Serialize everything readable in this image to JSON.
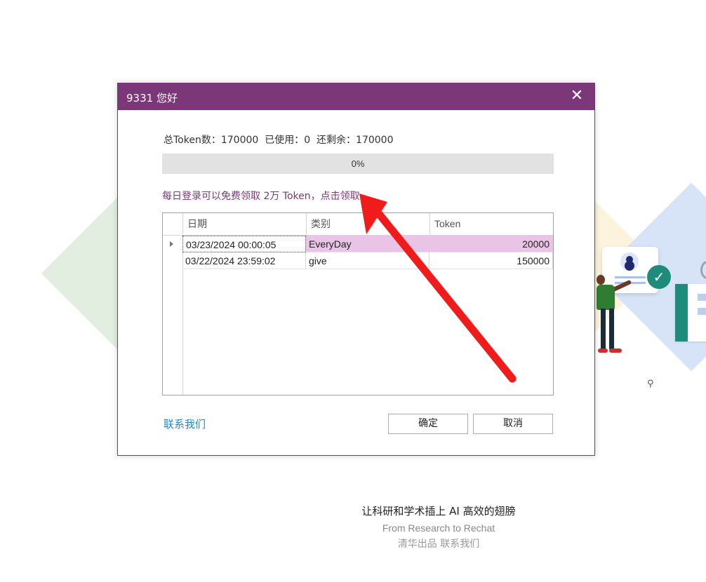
{
  "dialog": {
    "title": "9331 您好",
    "close_glyph": "✕",
    "summary": {
      "total_label": "总Token数：",
      "total_value": "170000",
      "used_label": "已使用：",
      "used_value": "0",
      "remaining_label": "还剩余：",
      "remaining_value": "170000"
    },
    "progress": {
      "text": "0%",
      "value_percent": 0
    },
    "promo": {
      "text": "每日登录可以免费领取 2万 Token，",
      "claim_link": "点击领取"
    },
    "table": {
      "columns": [
        "日期",
        "类别",
        "Token"
      ],
      "rows": [
        {
          "date": "03/23/2024 00:00:05",
          "type": "EveryDay",
          "token": "20000",
          "selected": true
        },
        {
          "date": "03/22/2024 23:59:02",
          "type": "give",
          "token": "150000",
          "selected": false
        }
      ]
    },
    "contact_link": "联系我们",
    "ok_button": "确定",
    "cancel_button": "取消"
  },
  "footer": {
    "slogan": "让科研和学术插上 AI 高效的翅膀",
    "subtitle": "From Research to Rechat",
    "credit": "清华出品",
    "contact": "联系我们"
  },
  "colors": {
    "title_bar": "#7c3779",
    "promo_text": "#7c3779",
    "selected_row": "#eac4e6",
    "link": "#2a86c8",
    "arrow": "#f01c1c"
  },
  "icons": {
    "close": "close-icon",
    "row_indicator": "triangle-right-icon",
    "annotation": "red-arrow-icon",
    "search": "search-icon"
  }
}
